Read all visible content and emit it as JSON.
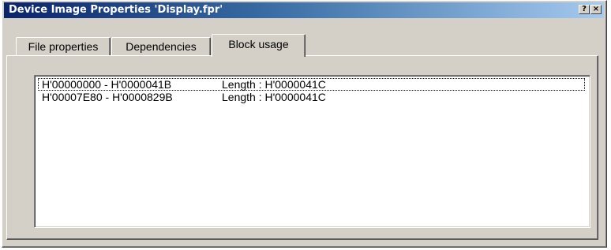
{
  "window": {
    "title": "Device Image Properties 'Display.fpr'",
    "help_button": "?",
    "close_button": "×"
  },
  "tabs": [
    {
      "label": "File properties",
      "selected": false
    },
    {
      "label": "Dependencies",
      "selected": false
    },
    {
      "label": "Block usage",
      "selected": true
    }
  ],
  "block_list": {
    "items": [
      {
        "range": "H'00000000 - H'0000041B",
        "length": "Length : H'0000041C",
        "focused": true
      },
      {
        "range": "H'00007E80 - H'0000829B",
        "length": "Length : H'0000041C",
        "focused": false
      }
    ]
  },
  "colors": {
    "title_start": "#0a246a",
    "title_end": "#a6caf0",
    "face": "#d4d0c8"
  }
}
